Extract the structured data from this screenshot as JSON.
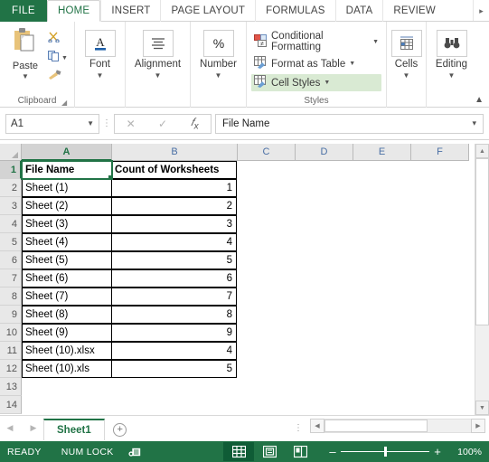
{
  "ribbon": {
    "file_tab": "FILE",
    "tabs": [
      {
        "label": "HOME",
        "active": true
      },
      {
        "label": "INSERT",
        "active": false
      },
      {
        "label": "PAGE LAYOUT",
        "active": false
      },
      {
        "label": "FORMULAS",
        "active": false
      },
      {
        "label": "DATA",
        "active": false
      },
      {
        "label": "REVIEW",
        "active": false
      }
    ],
    "more_tabs_icon": "chevron-right-icon",
    "collapse_icon": "chevron-up-icon",
    "groups": {
      "clipboard": {
        "label": "Clipboard",
        "paste_label": "Paste",
        "cut_icon": "scissors-icon",
        "copy_icon": "copy-icon",
        "format_painter_icon": "paintbrush-icon",
        "launcher_icon": "dialog-launcher-icon"
      },
      "font": {
        "label": "Font",
        "icon": "font-a-icon"
      },
      "alignment": {
        "label": "Alignment",
        "icon": "align-lines-icon"
      },
      "number": {
        "label": "Number",
        "icon": "percent-icon"
      },
      "styles": {
        "label": "Styles",
        "items": [
          {
            "label": "Conditional Formatting",
            "icon": "conditional-formatting-icon",
            "highlighted": false
          },
          {
            "label": "Format as Table",
            "icon": "format-as-table-icon",
            "highlighted": false
          },
          {
            "label": "Cell Styles",
            "icon": "cell-styles-icon",
            "highlighted": true
          }
        ]
      },
      "cells": {
        "label": "Cells",
        "icon": "cells-table-icon"
      },
      "editing": {
        "label": "Editing",
        "icon": "binoculars-icon"
      }
    }
  },
  "formula_bar": {
    "name_box_value": "A1",
    "cancel_icon": "x-icon",
    "confirm_icon": "check-icon",
    "fx_icon": "fx-icon",
    "formula_value": "File Name",
    "expand_icon": "chevron-down-icon"
  },
  "grid": {
    "column_headers": [
      "A",
      "B",
      "C",
      "D",
      "E",
      "F"
    ],
    "selected_column": "A",
    "selected_row": 1,
    "selected_cell": "A1",
    "row_numbers": [
      1,
      2,
      3,
      4,
      5,
      6,
      7,
      8,
      9,
      10,
      11,
      12,
      13,
      14
    ],
    "rows": [
      {
        "n": 1,
        "a": "File Name",
        "b": "Count of Worksheets",
        "bold": true
      },
      {
        "n": 2,
        "a": "Sheet (1)",
        "b": "1",
        "bold": false
      },
      {
        "n": 3,
        "a": "Sheet (2)",
        "b": "2",
        "bold": false
      },
      {
        "n": 4,
        "a": "Sheet (3)",
        "b": "3",
        "bold": false
      },
      {
        "n": 5,
        "a": "Sheet (4)",
        "b": "4",
        "bold": false
      },
      {
        "n": 6,
        "a": "Sheet (5)",
        "b": "5",
        "bold": false
      },
      {
        "n": 7,
        "a": "Sheet (6)",
        "b": "6",
        "bold": false
      },
      {
        "n": 8,
        "a": "Sheet (7)",
        "b": "7",
        "bold": false
      },
      {
        "n": 9,
        "a": "Sheet (8)",
        "b": "8",
        "bold": false
      },
      {
        "n": 10,
        "a": "Sheet (9)",
        "b": "9",
        "bold": false
      },
      {
        "n": 11,
        "a": "Sheet (10).xlsx",
        "b": "4",
        "bold": false
      },
      {
        "n": 12,
        "a": "Sheet (10).xls",
        "b": "5",
        "bold": false
      },
      {
        "n": 13,
        "a": "",
        "b": "",
        "bold": false
      },
      {
        "n": 14,
        "a": "",
        "b": "",
        "bold": false
      }
    ]
  },
  "sheet_tabs": {
    "first_icon": "nav-first-icon",
    "prev_icon": "nav-prev-icon",
    "tabs": [
      {
        "label": "Sheet1",
        "active": true
      }
    ],
    "add_sheet_icon": "plus-circle-icon"
  },
  "scrollbars": {
    "v_up_icon": "triangle-up-icon",
    "v_down_icon": "triangle-down-icon",
    "h_left_icon": "triangle-left-icon",
    "h_right_icon": "triangle-right-icon"
  },
  "status_bar": {
    "mode": "READY",
    "num_lock": "NUM LOCK",
    "record_macro_icon": "record-macro-icon",
    "views": [
      {
        "name": "normal-view",
        "icon": "grid-view-icon",
        "active": true
      },
      {
        "name": "page-layout-view",
        "icon": "page-layout-icon",
        "active": false
      },
      {
        "name": "page-break-view",
        "icon": "page-break-icon",
        "active": false
      }
    ],
    "zoom_out_label": "–",
    "zoom_in_label": "+",
    "zoom_level": "100%"
  },
  "colors": {
    "excel_green": "#217346",
    "ribbon_bg": "#ffffff",
    "header_gray": "#e8e8e8",
    "highlight_green": "#d9ead3"
  }
}
